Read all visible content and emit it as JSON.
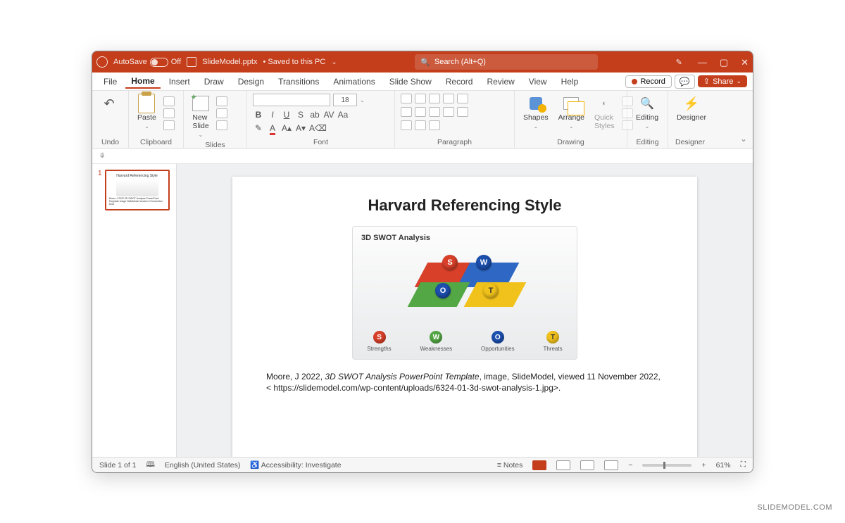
{
  "brand_color": "#C43E1C",
  "titlebar": {
    "autosave_label": "AutoSave",
    "autosave_state": "Off",
    "filename": "SlideModel.pptx",
    "save_state": "Saved to this PC",
    "search_placeholder": "Search (Alt+Q)"
  },
  "menubar": {
    "items": [
      "File",
      "Home",
      "Insert",
      "Draw",
      "Design",
      "Transitions",
      "Animations",
      "Slide Show",
      "Record",
      "Review",
      "View",
      "Help"
    ],
    "active": "Home",
    "record_btn": "Record",
    "share_btn": "Share"
  },
  "ribbon": {
    "groups": {
      "undo": {
        "label": "Undo"
      },
      "clipboard": {
        "label": "Clipboard",
        "paste": "Paste"
      },
      "slides": {
        "label": "Slides",
        "newslide": "New\nSlide"
      },
      "font": {
        "label": "Font",
        "size": "18"
      },
      "paragraph": {
        "label": "Paragraph"
      },
      "drawing": {
        "label": "Drawing",
        "shapes": "Shapes",
        "arrange": "Arrange",
        "quickstyles": "Quick\nStyles"
      },
      "editing": {
        "label": "Editing",
        "editing": "Editing"
      },
      "designer": {
        "label": "Designer",
        "designer": "Designer"
      }
    }
  },
  "thumbs": {
    "current": "1"
  },
  "slide": {
    "title": "Harvard Referencing Style",
    "figure_title": "3D SWOT Analysis",
    "legend": {
      "s": "Strengths",
      "w": "Weaknesses",
      "o": "Opportunities",
      "t": "Threats"
    },
    "citation_pre": "Moore, J 2022, ",
    "citation_title": "3D SWOT Analysis PowerPoint Template",
    "citation_post": ", image, SlideModel, viewed 11 November 2022, < https://slidemodel.com/wp-content/uploads/6324-01-3d-swot-analysis-1.jpg>."
  },
  "statusbar": {
    "slide_of": "Slide 1 of 1",
    "language": "English (United States)",
    "accessibility": "Accessibility: Investigate",
    "notes": "Notes",
    "zoom": "61%"
  },
  "watermark": "SLIDEMODEL.COM"
}
